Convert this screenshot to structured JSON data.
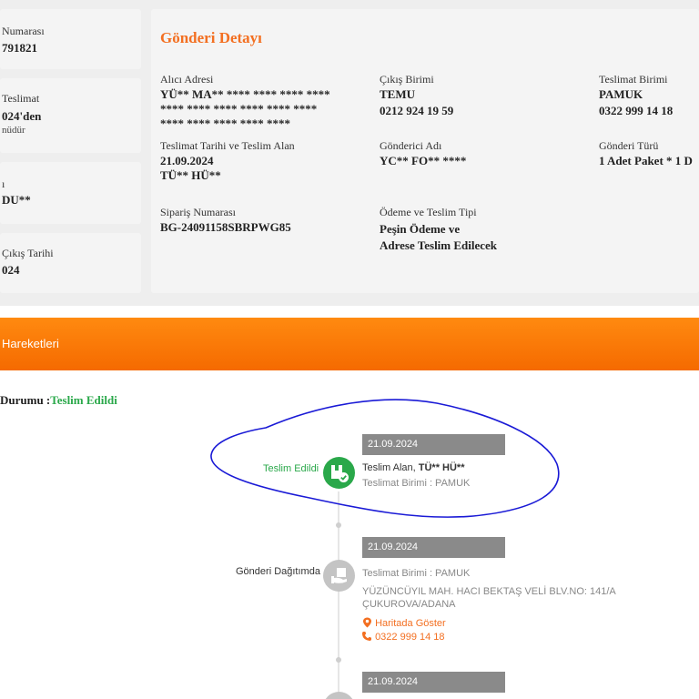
{
  "left_cards": [
    {
      "label": "Numarası",
      "value": "791821"
    },
    {
      "label": "Teslimat",
      "value": "024'den",
      "sub": "nüdür"
    },
    {
      "label": "ı",
      "value": "DU**"
    },
    {
      "label": "Çıkış Tarihi",
      "value": "024"
    }
  ],
  "detail": {
    "title": "Gönderi Detayı",
    "recipient_address_label": "Alıcı Adresi",
    "recipient_address_lines": [
      "YÜ** MA** **** **** **** ****",
      "**** **** **** **** **** ****",
      "**** **** **** **** ****"
    ],
    "exit_unit_label": "Çıkış Birimi",
    "exit_unit_name": "TEMU",
    "exit_unit_phone": "0212 924 19 59",
    "delivery_unit_label": "Teslimat Birimi",
    "delivery_unit_name": "PAMUK",
    "delivery_unit_phone": "0322 999 14 18",
    "delivery_date_label": "Teslimat Tarihi ve Teslim Alan",
    "delivery_date": "21.09.2024",
    "received_by": "TÜ** HÜ**",
    "sender_label": "Gönderici Adı",
    "sender": "YC** FO** ****",
    "shipment_type_label": "Gönderi Türü",
    "shipment_type": "1 Adet Paket * 1 D",
    "order_label": "Sipariş Numarası",
    "order_number": "BG-24091158SBRPWG85",
    "payment_label": "Ödeme ve Teslim Tipi",
    "payment_lines": [
      "Peşin Ödeme ve",
      "Adrese Teslim Edilecek"
    ]
  },
  "movements": {
    "header": "Hareketleri",
    "status_prefix": "Durumu :",
    "status_value": "Teslim Edildi",
    "events": [
      {
        "date": "21.09.2024",
        "name": "Teslim Edildi",
        "line1_prefix": "Teslim Alan, ",
        "line1_bold": "TÜ** HÜ**",
        "line2": "Teslimat Birimi : PAMUK"
      },
      {
        "date": "21.09.2024",
        "name": "Gönderi Dağıtımda",
        "line1": "Teslimat Birimi : PAMUK",
        "address1": "YÜZÜNCÜYIL MAH. HACI BEKTAŞ VELİ BLV.NO: 141/A",
        "address2": "ÇUKUROVA/ADANA",
        "map_link": "Haritada Göster",
        "phone": "0322 999 14 18"
      },
      {
        "date": "21.09.2024"
      }
    ]
  },
  "colors": {
    "accent": "#f36f21",
    "delivered_green": "#2aa84a",
    "annotation_blue": "#1a1ad6"
  },
  "icons": {
    "delivered": "delivered-package-check-icon",
    "in_distribution": "hand-package-icon",
    "map": "map-pin-icon",
    "phone": "phone-icon"
  }
}
